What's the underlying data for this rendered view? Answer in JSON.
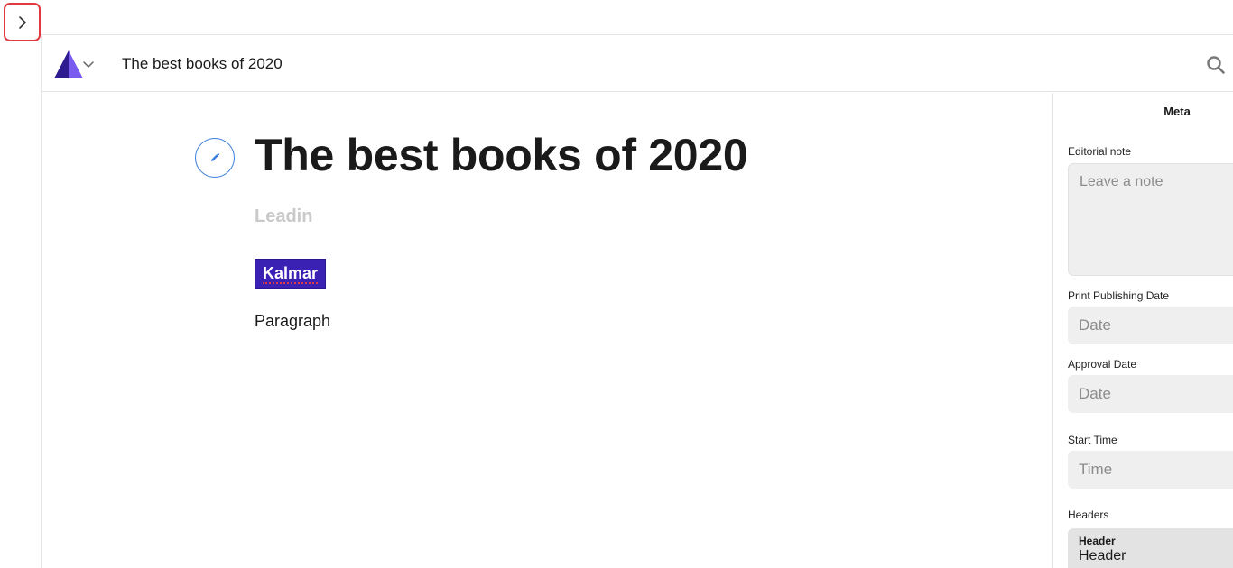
{
  "document": {
    "title": "The best books of 2020"
  },
  "editor": {
    "headline": "The best books of 2020",
    "leadin_placeholder": "Leadin",
    "tag": "Kalmar",
    "paragraph": "Paragraph"
  },
  "meta_panel": {
    "title": "Meta",
    "editorial_note": {
      "label": "Editorial note",
      "placeholder": "Leave a note"
    },
    "print_publishing_date": {
      "label": "Print Publishing Date",
      "placeholder": "Date"
    },
    "approval_date": {
      "label": "Approval Date",
      "placeholder": "Date"
    },
    "start_time": {
      "label": "Start Time",
      "placeholder": "Time"
    },
    "headers": {
      "label": "Headers",
      "card_label": "Header",
      "card_value": "Header"
    }
  },
  "icons": {
    "expand": "chevron-right-icon",
    "logo": "triangle-logo",
    "logo_menu": "chevron-down-icon",
    "search": "search-icon",
    "edit": "pencil-icon"
  },
  "colors": {
    "tag_background": "#3a21b4",
    "accent_blue": "#3b7ddd",
    "highlight_red": "#e0393f"
  }
}
